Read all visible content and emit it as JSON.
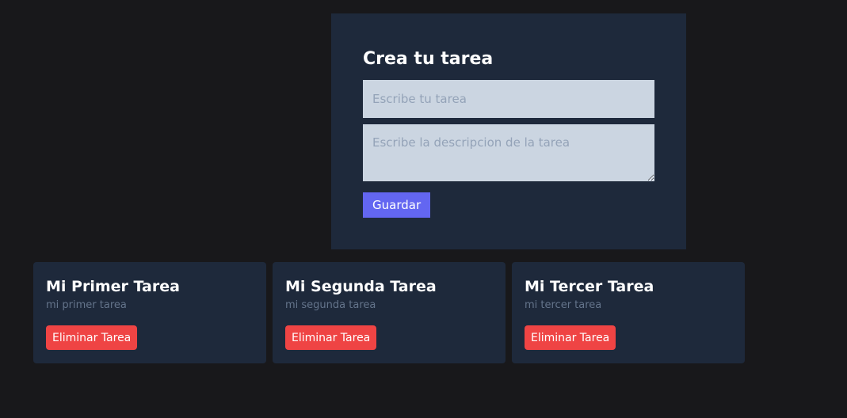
{
  "form": {
    "title": "Crea tu tarea",
    "title_placeholder": "Escribe tu tarea",
    "title_value": "",
    "description_placeholder": "Escribe la descripcion de la tarea",
    "description_value": "",
    "save_label": "Guardar"
  },
  "tasks": [
    {
      "title": "Mi Primer Tarea",
      "description": "mi primer tarea",
      "delete_label": "Eliminar Tarea"
    },
    {
      "title": "Mi Segunda Tarea",
      "description": "mi segunda tarea",
      "delete_label": "Eliminar Tarea"
    },
    {
      "title": "Mi Tercer Tarea",
      "description": "mi tercer tarea",
      "delete_label": "Eliminar Tarea"
    }
  ],
  "colors": {
    "background": "#18181b",
    "card": "#1e293b",
    "input": "#cbd5e1",
    "primary_button": "#6366f1",
    "danger_button": "#ef4444"
  }
}
